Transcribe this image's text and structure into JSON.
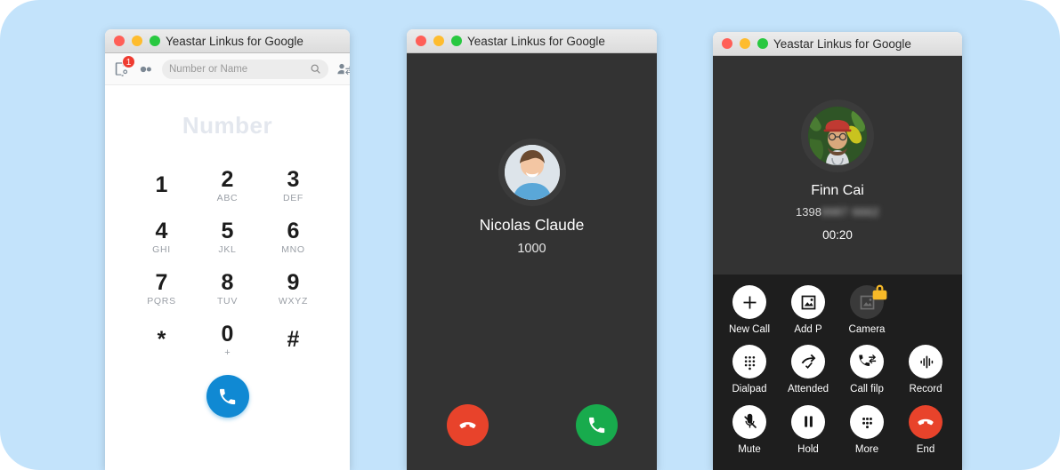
{
  "app": {
    "window_title": "Yeastar Linkus for Google",
    "background_color": "#c3e3fb"
  },
  "window_dialer": {
    "title": "Yeastar Linkus for Google",
    "traffic_lights": [
      "close",
      "minimize",
      "zoom"
    ],
    "toolbar": {
      "voicemail_icon": "voicemail-icon",
      "voicemail_badge": "1",
      "contacts_icon": "contacts-icon",
      "search_placeholder": "Number or Name",
      "search_value": "",
      "search_icon": "search-icon",
      "transfer_icon": "user-transfer-icon",
      "avatar": "user-avatar",
      "presence_status": "available"
    },
    "number_display": "Number",
    "keypad": [
      {
        "digit": "1",
        "letters": ""
      },
      {
        "digit": "2",
        "letters": "ABC"
      },
      {
        "digit": "3",
        "letters": "DEF"
      },
      {
        "digit": "4",
        "letters": "GHI"
      },
      {
        "digit": "5",
        "letters": "JKL"
      },
      {
        "digit": "6",
        "letters": "MNO"
      },
      {
        "digit": "7",
        "letters": "PQRS"
      },
      {
        "digit": "8",
        "letters": "TUV"
      },
      {
        "digit": "9",
        "letters": "WXYZ"
      },
      {
        "digit": "*",
        "letters": ""
      },
      {
        "digit": "0",
        "letters": "+"
      },
      {
        "digit": "#",
        "letters": ""
      }
    ],
    "call_button": {
      "icon": "phone-icon",
      "color": "#1089d3"
    }
  },
  "window_incoming": {
    "title": "Yeastar Linkus for Google",
    "caller_name": "Nicolas Claude",
    "caller_extension": "1000",
    "avatar": "caller-avatar",
    "decline_button": {
      "icon": "phone-hangup-icon",
      "color": "#e8432b"
    },
    "accept_button": {
      "icon": "phone-icon",
      "color": "#18ab4d"
    }
  },
  "window_incall": {
    "title": "Yeastar Linkus for Google",
    "caller_name": "Finn Cai",
    "caller_number_visible": "1398",
    "caller_number_masked": "9987 6662",
    "call_timer": "00:20",
    "avatar": "caller-avatar",
    "actions": [
      {
        "label": "New Call",
        "icon": "plus-icon",
        "state": "enabled"
      },
      {
        "label": "Add P",
        "icon": "image-add-icon",
        "state": "enabled"
      },
      {
        "label": "Camera",
        "icon": "camera-image-icon",
        "state": "locked"
      },
      {
        "label": "Dialpad",
        "icon": "dialpad-icon",
        "state": "enabled"
      },
      {
        "label": "Attended",
        "icon": "attended-transfer-icon",
        "state": "enabled"
      },
      {
        "label": "Call filp",
        "icon": "call-flip-icon",
        "state": "enabled"
      },
      {
        "label": "Record",
        "icon": "record-waveform-icon",
        "state": "enabled"
      },
      {
        "label": "Mute",
        "icon": "mic-off-icon",
        "state": "enabled"
      },
      {
        "label": "Hold",
        "icon": "pause-icon",
        "state": "enabled"
      },
      {
        "label": "More",
        "icon": "more-dots-icon",
        "state": "enabled"
      },
      {
        "label": "End",
        "icon": "phone-hangup-icon",
        "state": "end"
      }
    ]
  }
}
